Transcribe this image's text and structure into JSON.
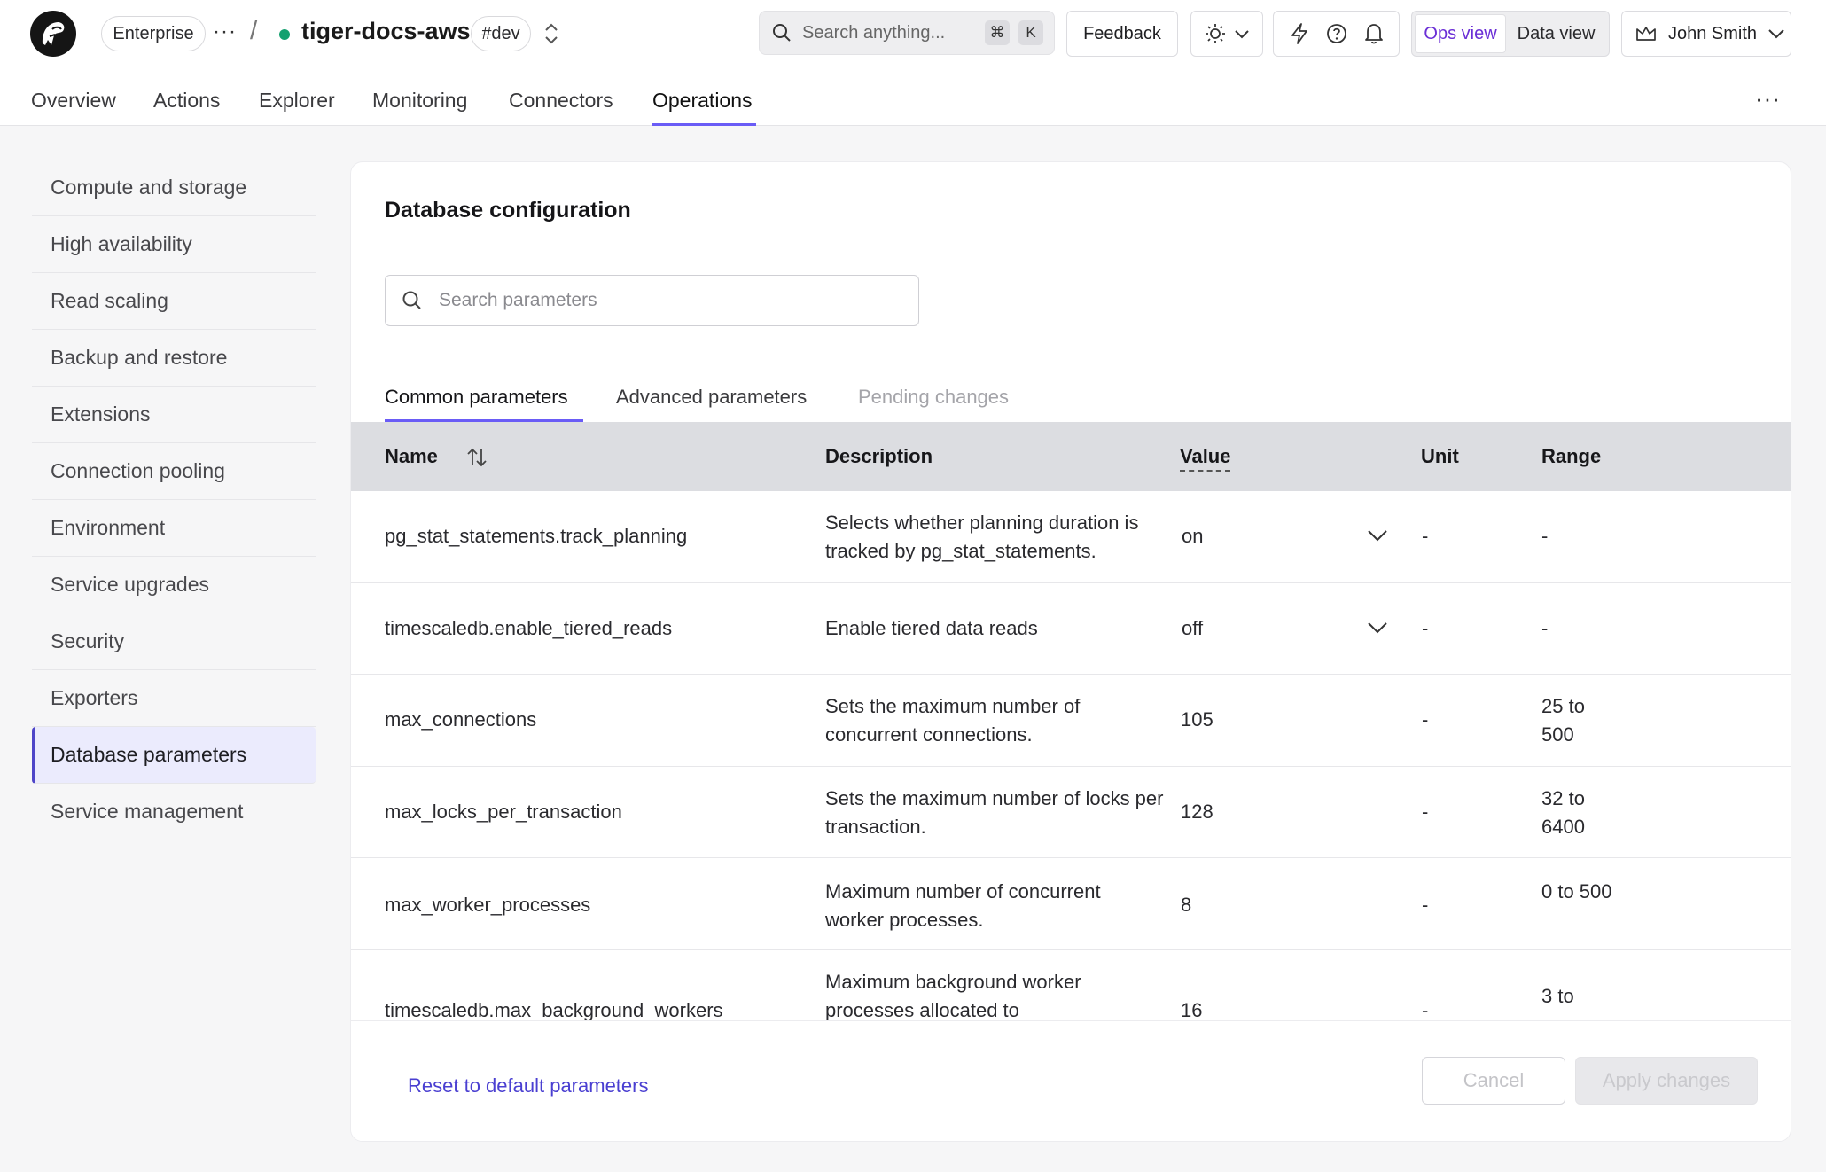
{
  "header": {
    "plan_badge": "Enterprise",
    "more_label": "···",
    "separator": "/",
    "service_name": "tiger-docs-aws",
    "env_badge": "#dev",
    "search": {
      "placeholder": "Search anything...",
      "key1": "⌘",
      "key2": "K"
    },
    "feedback_label": "Feedback",
    "views": {
      "ops": "Ops view",
      "data": "Data view",
      "active": "Ops view"
    },
    "user_name": "John Smith",
    "colors": {
      "status_dot": "#14a06f",
      "accent": "#6a5cf6",
      "ops_view": "#6b2fd6"
    }
  },
  "nav": {
    "tabs": [
      {
        "label": "Overview"
      },
      {
        "label": "Actions"
      },
      {
        "label": "Explorer"
      },
      {
        "label": "Monitoring"
      },
      {
        "label": "Connectors"
      },
      {
        "label": "Operations"
      }
    ],
    "active": "Operations",
    "more_label": "···"
  },
  "sidebar": {
    "items": [
      {
        "label": "Compute and storage"
      },
      {
        "label": "High availability"
      },
      {
        "label": "Read scaling"
      },
      {
        "label": "Backup and restore"
      },
      {
        "label": "Extensions"
      },
      {
        "label": "Connection pooling"
      },
      {
        "label": "Environment"
      },
      {
        "label": "Service upgrades"
      },
      {
        "label": "Security"
      },
      {
        "label": "Exporters"
      },
      {
        "label": "Database parameters"
      },
      {
        "label": "Service management"
      }
    ],
    "active": "Database parameters"
  },
  "main": {
    "title": "Database configuration",
    "search_placeholder": "Search parameters",
    "tabs": [
      {
        "label": "Common parameters"
      },
      {
        "label": "Advanced parameters"
      },
      {
        "label": "Pending changes"
      }
    ],
    "active_tab": "Common parameters",
    "table": {
      "headers": {
        "name": "Name",
        "description": "Description",
        "value": "Value",
        "unit": "Unit",
        "range": "Range"
      },
      "rows": [
        {
          "name": "pg_stat_statements.track_planning",
          "description": "Selects whether planning duration is tracked by pg_stat_statements.",
          "value": "on",
          "has_dropdown": true,
          "unit": "-",
          "range": "-"
        },
        {
          "name": "timescaledb.enable_tiered_reads",
          "description": "Enable tiered data reads",
          "value": "off",
          "has_dropdown": true,
          "unit": "-",
          "range": "-"
        },
        {
          "name": "max_connections",
          "description": "Sets the maximum number of concurrent connections.",
          "value": "105",
          "has_dropdown": false,
          "unit": "-",
          "range": "25 to 500"
        },
        {
          "name": "max_locks_per_transaction",
          "description": "Sets the maximum number of locks per transaction.",
          "value": "128",
          "has_dropdown": false,
          "unit": "-",
          "range": "32 to 6400"
        },
        {
          "name": "max_worker_processes",
          "description": "Maximum number of concurrent worker processes.",
          "value": "8",
          "has_dropdown": false,
          "unit": "-",
          "range": "0 to 500"
        },
        {
          "name": "timescaledb.max_background_workers",
          "description": "Maximum background worker processes allocated to",
          "value": "16",
          "has_dropdown": false,
          "unit": "-",
          "range": "3 to"
        }
      ]
    },
    "footer": {
      "reset_label": "Reset to default parameters",
      "cancel_label": "Cancel",
      "apply_label": "Apply changes"
    }
  }
}
